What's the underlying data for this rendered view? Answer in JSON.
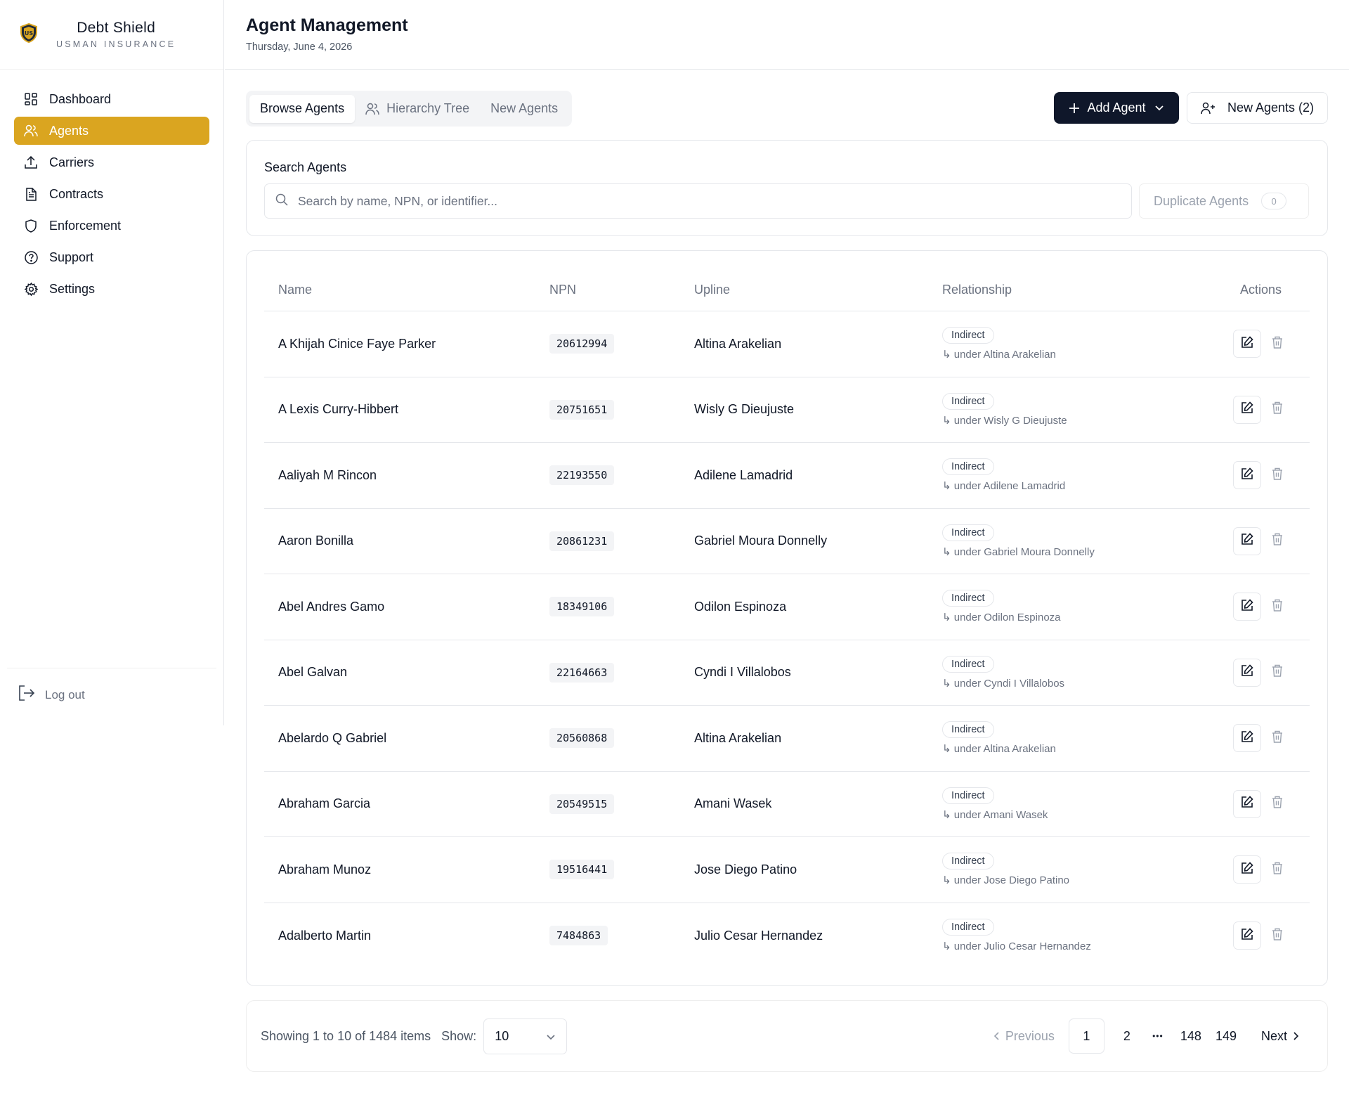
{
  "brand": {
    "name": "Debt Shield",
    "subtitle": "USMAN INSURANCE"
  },
  "sidebar": {
    "items": [
      {
        "label": "Dashboard",
        "icon": "dashboard-grid-icon",
        "active": false
      },
      {
        "label": "Agents",
        "icon": "users-icon",
        "active": true
      },
      {
        "label": "Carriers",
        "icon": "upload-icon",
        "active": false
      },
      {
        "label": "Contracts",
        "icon": "document-icon",
        "active": false
      },
      {
        "label": "Enforcement",
        "icon": "shield-icon",
        "active": false
      },
      {
        "label": "Support",
        "icon": "help-circle-icon",
        "active": false
      },
      {
        "label": "Settings",
        "icon": "gear-icon",
        "active": false
      }
    ],
    "logout_label": "Log out"
  },
  "header": {
    "title": "Agent Management",
    "date": "Thursday, June 4, 2026"
  },
  "tabs": [
    {
      "label": "Browse Agents",
      "active": true
    },
    {
      "label": "Hierarchy Tree",
      "active": false
    },
    {
      "label": "New Agents",
      "active": false
    }
  ],
  "actions": {
    "add_agent_label": "Add Agent",
    "new_agents_label": "New Agents (2)"
  },
  "search": {
    "label": "Search Agents",
    "placeholder": "Search by name, NPN, or identifier...",
    "value": "",
    "duplicate_label": "Duplicate Agents",
    "duplicate_count": "0"
  },
  "table": {
    "columns": {
      "name": "Name",
      "npn": "NPN",
      "upline": "Upline",
      "relationship": "Relationship",
      "actions": "Actions"
    },
    "rows": [
      {
        "name": "A Khijah Cinice Faye Parker",
        "npn": "20612994",
        "upline": "Altina Arakelian",
        "relationship": "Indirect",
        "rel_sub": "↳ under Altina Arakelian"
      },
      {
        "name": "A Lexis Curry-Hibbert",
        "npn": "20751651",
        "upline": "Wisly G Dieujuste",
        "relationship": "Indirect",
        "rel_sub": "↳ under Wisly G Dieujuste"
      },
      {
        "name": "Aaliyah M Rincon",
        "npn": "22193550",
        "upline": "Adilene Lamadrid",
        "relationship": "Indirect",
        "rel_sub": "↳ under Adilene Lamadrid"
      },
      {
        "name": "Aaron Bonilla",
        "npn": "20861231",
        "upline": "Gabriel Moura Donnelly",
        "relationship": "Indirect",
        "rel_sub": "↳ under Gabriel Moura Donnelly"
      },
      {
        "name": "Abel Andres Gamo",
        "npn": "18349106",
        "upline": "Odilon Espinoza",
        "relationship": "Indirect",
        "rel_sub": "↳ under Odilon Espinoza"
      },
      {
        "name": "Abel Galvan",
        "npn": "22164663",
        "upline": "Cyndi I Villalobos",
        "relationship": "Indirect",
        "rel_sub": "↳ under Cyndi I Villalobos"
      },
      {
        "name": "Abelardo Q Gabriel",
        "npn": "20560868",
        "upline": "Altina Arakelian",
        "relationship": "Indirect",
        "rel_sub": "↳ under Altina Arakelian"
      },
      {
        "name": "Abraham Garcia",
        "npn": "20549515",
        "upline": "Amani Wasek",
        "relationship": "Indirect",
        "rel_sub": "↳ under Amani Wasek"
      },
      {
        "name": "Abraham Munoz",
        "npn": "19516441",
        "upline": "Jose Diego Patino",
        "relationship": "Indirect",
        "rel_sub": "↳ under Jose Diego Patino"
      },
      {
        "name": "Adalberto Martin",
        "npn": "7484863",
        "upline": "Julio Cesar Hernandez",
        "relationship": "Indirect",
        "rel_sub": "↳ under Julio Cesar Hernandez"
      }
    ]
  },
  "pagination": {
    "showing_text": "Showing 1 to 10 of 1484 items",
    "show_label": "Show:",
    "page_size": "10",
    "prev_label": "Previous",
    "next_label": "Next",
    "pages": [
      "1",
      "2",
      "148",
      "149"
    ],
    "ellipsis": "•••",
    "current_page": "1"
  },
  "colors": {
    "accent": "#daa520",
    "primary_button": "#0f172a",
    "border": "#e5e7eb",
    "muted_text": "#6b7280"
  }
}
